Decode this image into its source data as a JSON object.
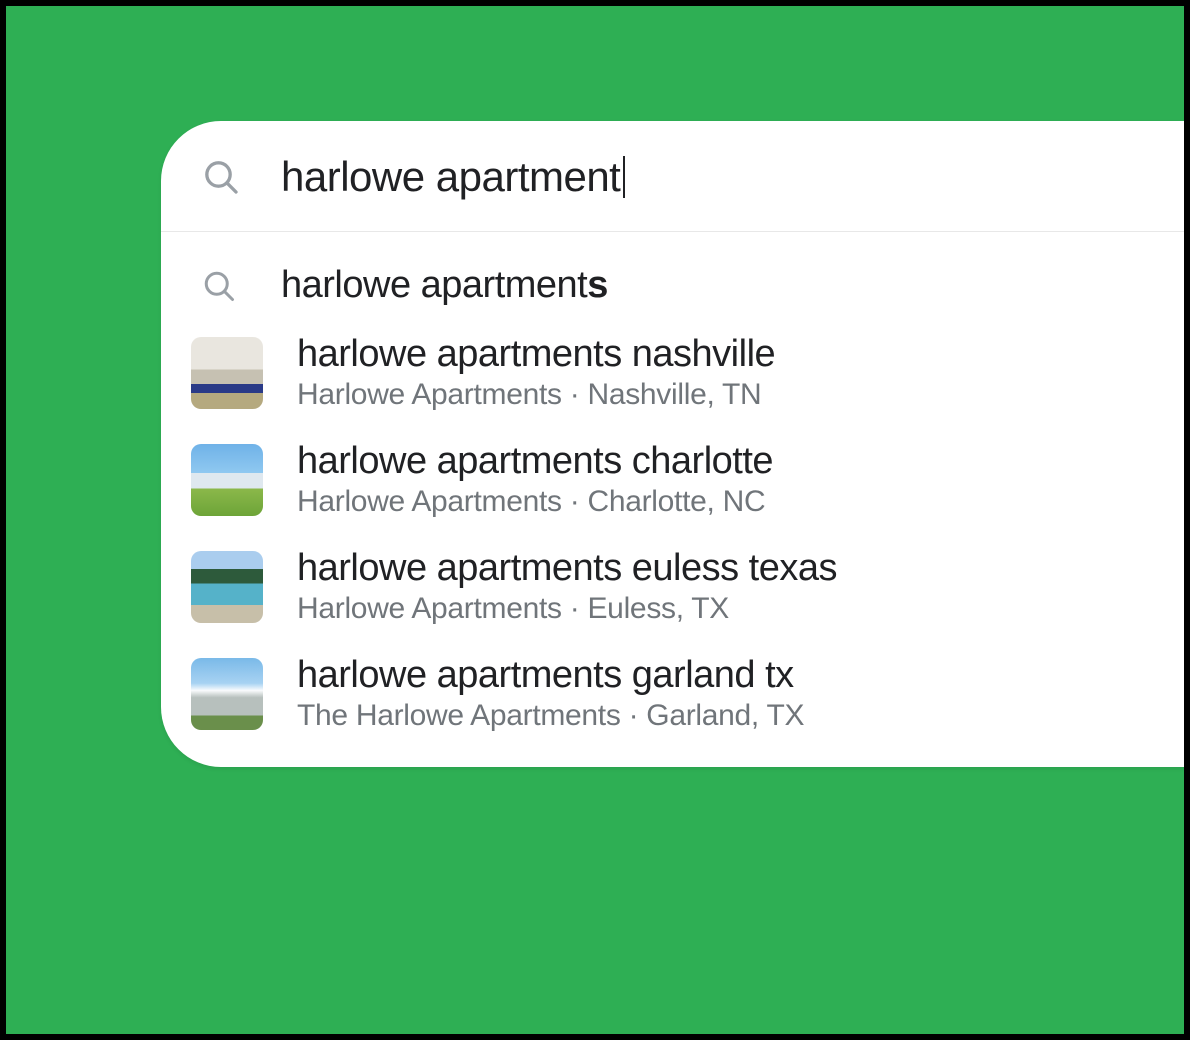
{
  "colors": {
    "accent_green": "#2EAF54",
    "text_primary": "#202124",
    "text_secondary": "#70757a",
    "icon_gray": "#9AA0A6"
  },
  "search": {
    "query": "harlowe apartment",
    "icon": "search-icon"
  },
  "suggestions": [
    {
      "type": "simple",
      "title_prefix": "harlowe apartment",
      "title_suffix": "s",
      "icon": "search-icon"
    },
    {
      "type": "place",
      "title": "harlowe apartments nashville",
      "subtitle": "Harlowe Apartments · Nashville, TN",
      "thumb": "interior"
    },
    {
      "type": "place",
      "title": "harlowe apartments charlotte",
      "subtitle": "Harlowe Apartments · Charlotte, NC",
      "thumb": "lawn"
    },
    {
      "type": "place",
      "title": "harlowe apartments euless texas",
      "subtitle": "Harlowe Apartments · Euless, TX",
      "thumb": "pool"
    },
    {
      "type": "place",
      "title": "harlowe apartments garland tx",
      "subtitle": "The Harlowe Apartments · Garland, TX",
      "thumb": "building"
    }
  ]
}
